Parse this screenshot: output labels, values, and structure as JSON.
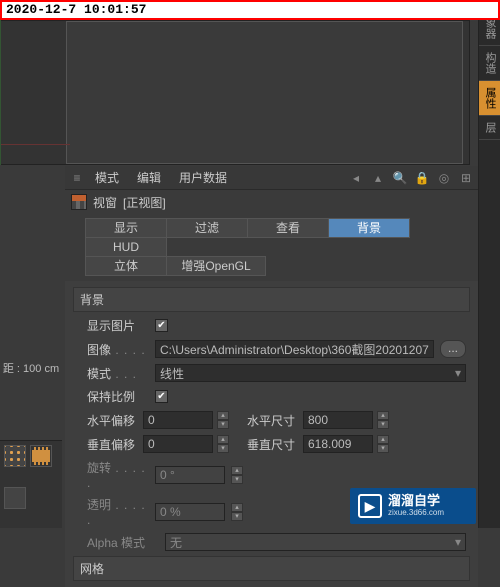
{
  "timestamp": "2020-12-7 10:01:57",
  "right_tabs": [
    "对象器",
    "构造",
    "属性",
    "层"
  ],
  "right_tab_active": "属性",
  "menubar": {
    "mode": "模式",
    "edit": "编辑",
    "user_data": "用户数据"
  },
  "title": {
    "view": "视窗",
    "sub": "[正视图]"
  },
  "tabs": {
    "row1": [
      "显示",
      "过滤",
      "查看",
      "背景",
      "HUD"
    ],
    "row2": [
      "立体",
      "增强OpenGL"
    ],
    "active": "背景"
  },
  "section_title": "背景",
  "fields": {
    "show_image_label": "显示图片",
    "show_image_checked": "✔",
    "image_label": "图像",
    "image_path": "C:\\Users\\Administrator\\Desktop\\360截图20201207",
    "browse": "...",
    "mode_label": "模式",
    "mode_value": "线性",
    "keep_ratio_label": "保持比例",
    "keep_ratio_checked": "✔",
    "h_offset_label": "水平偏移",
    "h_offset_value": "0",
    "h_size_label": "水平尺寸",
    "h_size_value": "800",
    "v_offset_label": "垂直偏移",
    "v_offset_value": "0",
    "v_size_label": "垂直尺寸",
    "v_size_value": "618.009",
    "rotate_label": "旋转",
    "rotate_value": "0 °",
    "opacity_label": "透明",
    "opacity_value": "0 %",
    "alpha_label": "Alpha 模式",
    "alpha_value": "无"
  },
  "mesh_section": "网格",
  "left_status": "距 : 100 cm",
  "watermark": {
    "brand": "溜溜自学",
    "url": "zixue.3d66.com"
  }
}
